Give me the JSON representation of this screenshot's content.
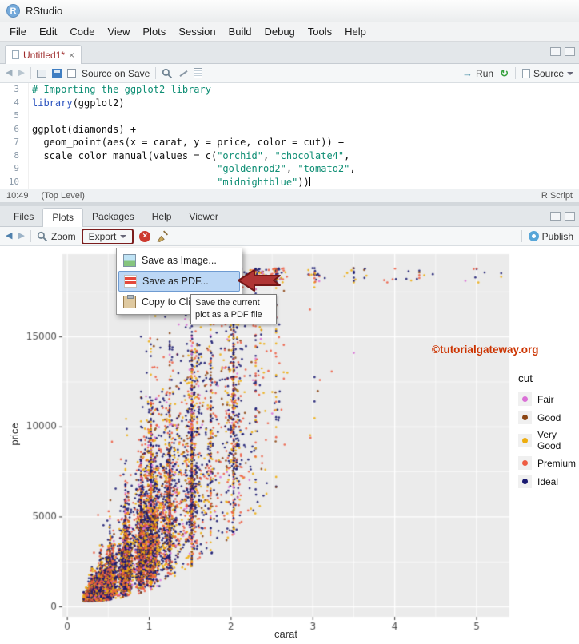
{
  "window": {
    "title": "RStudio"
  },
  "menubar": {
    "items": [
      "File",
      "Edit",
      "Code",
      "View",
      "Plots",
      "Session",
      "Build",
      "Debug",
      "Tools",
      "Help"
    ]
  },
  "editor": {
    "tab_label": "Untitled1*",
    "toolbar": {
      "source_on_save_label": "Source on Save",
      "run_label": "Run",
      "source_label": "Source"
    },
    "code_lines": [
      {
        "n": "3",
        "parts": [
          {
            "t": "# Importing the ggplot2 library",
            "c": "comment"
          }
        ]
      },
      {
        "n": "4",
        "parts": [
          {
            "t": "library",
            "c": "fn"
          },
          {
            "t": "(ggplot2)",
            "c": "plain"
          }
        ]
      },
      {
        "n": "5",
        "parts": []
      },
      {
        "n": "6",
        "parts": [
          {
            "t": "ggplot(diamonds) +",
            "c": "plain"
          }
        ]
      },
      {
        "n": "7",
        "parts": [
          {
            "t": "  geom_point(aes(x = carat, y = price, color = cut)) +",
            "c": "plain"
          }
        ]
      },
      {
        "n": "8",
        "parts": [
          {
            "t": "  scale_color_manual(values = c(",
            "c": "plain"
          },
          {
            "t": "\"orchid\"",
            "c": "string"
          },
          {
            "t": ", ",
            "c": "plain"
          },
          {
            "t": "\"chocolate4\"",
            "c": "string"
          },
          {
            "t": ",",
            "c": "plain"
          }
        ]
      },
      {
        "n": "9",
        "parts": [
          {
            "t": "                                ",
            "c": "plain"
          },
          {
            "t": "\"goldenrod2\"",
            "c": "string"
          },
          {
            "t": ", ",
            "c": "plain"
          },
          {
            "t": "\"tomato2\"",
            "c": "string"
          },
          {
            "t": ",",
            "c": "plain"
          }
        ]
      },
      {
        "n": "10",
        "parts": [
          {
            "t": "                                ",
            "c": "plain"
          },
          {
            "t": "\"midnightblue\"",
            "c": "string"
          },
          {
            "t": "))",
            "c": "plain"
          }
        ],
        "cursor": true
      }
    ],
    "status": {
      "position": "10:49",
      "scope": "(Top Level)",
      "file_type": "R Script"
    }
  },
  "plots_pane": {
    "tabs": [
      {
        "label": "Files"
      },
      {
        "label": "Plots",
        "active": true
      },
      {
        "label": "Packages"
      },
      {
        "label": "Help"
      },
      {
        "label": "Viewer"
      }
    ],
    "toolbar": {
      "zoom_label": "Zoom",
      "export_label": "Export",
      "publish_label": "Publish"
    }
  },
  "export_menu": {
    "items": [
      {
        "label": "Save as Image...",
        "icon": "image-icon"
      },
      {
        "label": "Save as PDF...",
        "icon": "pdf-icon",
        "selected": true
      },
      {
        "label": "Copy to Clipb...",
        "icon": "clipboard-icon"
      }
    ]
  },
  "tooltip": {
    "text": "Save the current plot as a PDF file"
  },
  "watermark": {
    "text": "©tutorialgateway.org",
    "color": "#cc3300"
  },
  "chart_data": {
    "type": "scatter",
    "title": "",
    "xlabel": "carat",
    "ylabel": "price",
    "x_ticks": [
      0,
      1,
      2,
      3,
      4,
      5
    ],
    "y_ticks": [
      0,
      5000,
      10000,
      15000
    ],
    "xlim": [
      -0.06,
      5.4
    ],
    "ylim": [
      -550,
      19600
    ],
    "panel_bg": "#ebebeb",
    "grid": "white major and minor gridlines on gray panel",
    "legend": {
      "title": "cut",
      "position": "right",
      "entries": [
        {
          "label": "Fair",
          "color": "#da70d6"
        },
        {
          "label": "Good",
          "color": "#8b4513"
        },
        {
          "label": "Very Good",
          "color": "#eead0e"
        },
        {
          "label": "Premium",
          "color": "#ee5c42"
        },
        {
          "label": "Ideal",
          "color": "#191970"
        }
      ]
    },
    "source": "ggplot2 diamonds dataset: price vs carat colored by cut (~53,940 points, rendered as a dense synthetic cloud)",
    "point_cloud": {
      "n": 12000,
      "carat_bands": [
        [
          0.3,
          0.05,
          16
        ],
        [
          0.41,
          0.03,
          8
        ],
        [
          0.52,
          0.04,
          11
        ],
        [
          0.71,
          0.04,
          11
        ],
        [
          0.9,
          0.04,
          6
        ],
        [
          1.02,
          0.06,
          13
        ],
        [
          1.25,
          0.08,
          7
        ],
        [
          1.52,
          0.06,
          6
        ],
        [
          1.75,
          0.08,
          2.5
        ],
        [
          2.03,
          0.06,
          5
        ],
        [
          2.3,
          0.1,
          1.5
        ],
        [
          2.55,
          0.08,
          0.7
        ],
        [
          3.02,
          0.05,
          0.3
        ],
        [
          3.5,
          0.4,
          0.12
        ],
        [
          4.3,
          0.4,
          0.08
        ],
        [
          5.0,
          0.15,
          0.05
        ]
      ],
      "cut_weights": [
        0.05,
        0.09,
        0.22,
        0.25,
        0.39
      ],
      "price_model": "price ~ 3900*carat^1.65 * lognormal(0,0.5), clamped to [330, 18820]"
    }
  }
}
